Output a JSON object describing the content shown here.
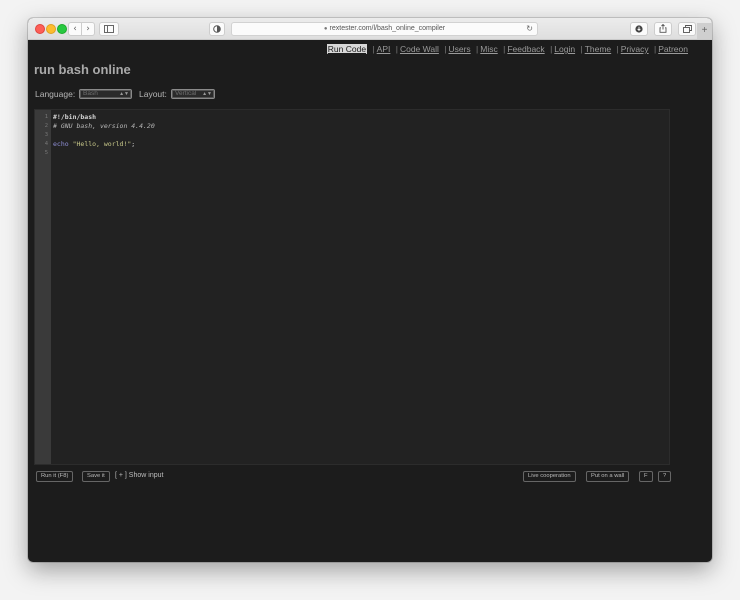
{
  "browser": {
    "url": "rextester.com/l/bash_online_compiler",
    "back_icon": "‹",
    "forward_icon": "›",
    "newtab_icon": "+"
  },
  "nav": {
    "items": [
      {
        "label": "Run Code",
        "active": true
      },
      {
        "label": "API"
      },
      {
        "label": "Code Wall"
      },
      {
        "label": "Users"
      },
      {
        "label": "Misc"
      },
      {
        "label": "Feedback"
      },
      {
        "label": "Login"
      },
      {
        "label": "Theme"
      },
      {
        "label": "Privacy"
      },
      {
        "label": "Patreon"
      }
    ],
    "separator": "|"
  },
  "page": {
    "title": "run bash online"
  },
  "controls": {
    "language_label": "Language:",
    "language_value": "Bash",
    "layout_label": "Layout:",
    "layout_value": "Vertical"
  },
  "editor": {
    "line_numbers": [
      "1",
      "2",
      "3",
      "4",
      "5"
    ],
    "lines": {
      "l1": "#!/bin/bash",
      "l2": "# GNU bash, version 4.4.20",
      "l4_kw": "echo",
      "l4_str": "\"Hello, world!\"",
      "l4_end": ";"
    }
  },
  "bottom": {
    "run_label": "Run it (F8)",
    "save_label": "Save it",
    "show_input_label": "[ + ] Show input",
    "live_label": "Live cooperation",
    "wall_label": "Put on a wall",
    "f_label": "F",
    "help_label": "?"
  }
}
